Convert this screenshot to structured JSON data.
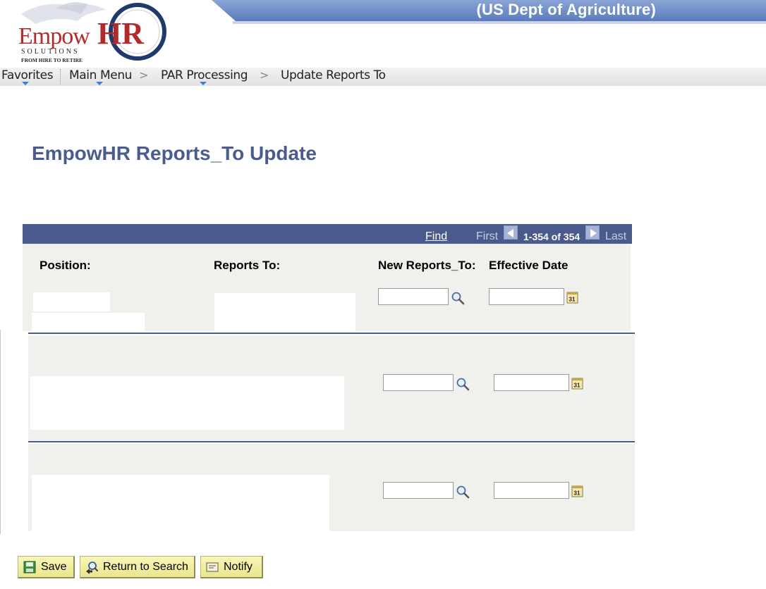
{
  "header": {
    "org_name": "(US Dept of Agriculture)",
    "logo_text": {
      "brand_left": "Empow",
      "brand_right": "HR",
      "solutions": "SOLUTIONS",
      "tagline": "FROM HIRE TO RETIRE"
    }
  },
  "breadcrumb": {
    "favorites": "Favorites",
    "main_menu": "Main Menu",
    "par_processing": "PAR Processing",
    "current": "Update Reports To",
    "separator": ">"
  },
  "page": {
    "title": "EmpowHR Reports_To Update"
  },
  "grid": {
    "find": "Find",
    "first": "First",
    "range": "1-354 of 354",
    "last": "Last",
    "columns": {
      "position": "Position:",
      "reports_to": "Reports To:",
      "new_reports_to": "New Reports_To:",
      "effective_date": "Effective Date"
    },
    "rows": [
      {
        "new_reports_to": "",
        "effective_date": ""
      },
      {
        "new_reports_to": "",
        "effective_date": ""
      },
      {
        "new_reports_to": "",
        "effective_date": ""
      }
    ]
  },
  "actions": {
    "save": "Save",
    "return_to_search": "Return to Search",
    "notify": "Notify"
  },
  "colors": {
    "banner": "#6c8cc8",
    "title": "#4a5b8e",
    "grid_header": "#4b5a8d",
    "row_bg": "#f0f1ec",
    "button_bg": "#f3f0a8"
  }
}
